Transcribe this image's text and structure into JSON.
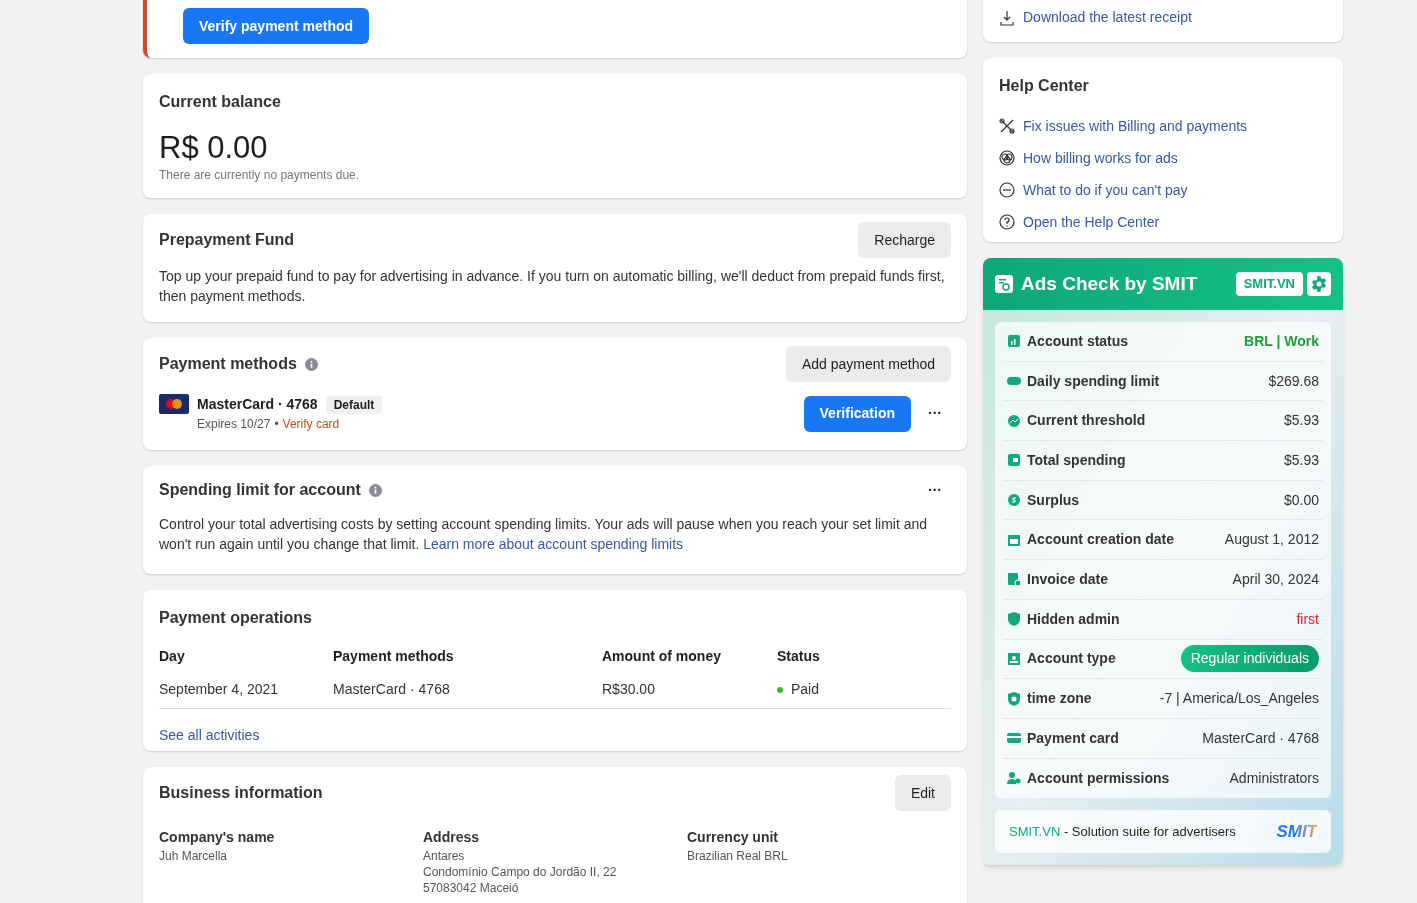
{
  "alert_card": {
    "button": "Verify payment method"
  },
  "balance": {
    "title": "Current balance",
    "amount": "R$ 0.00",
    "note": "There are currently no payments due."
  },
  "prepayment": {
    "title": "Prepayment Fund",
    "button": "Recharge",
    "text": "Top up your prepaid fund to pay for advertising in advance. If you turn on automatic billing, we'll deduct from prepaid funds first, then payment methods."
  },
  "payment_methods": {
    "title": "Payment methods",
    "button": "Add payment method",
    "card": {
      "name": "MasterCard · 4768",
      "badge": "Default",
      "expires": "Expires 10/27",
      "separator": "•",
      "verify": "Verify card",
      "button": "Verification",
      "more": "···"
    }
  },
  "spending_limit": {
    "title": "Spending limit for account",
    "more": "···",
    "text": "Control your total advertising costs by setting account spending limits. Your ads will pause when you reach your set limit and won't run again until you change that limit.",
    "link": "Learn more about account spending limits"
  },
  "payment_operations": {
    "title": "Payment operations",
    "columns": [
      "Day",
      "Payment methods",
      "Amount of money",
      "Status"
    ],
    "rows": [
      {
        "day": "September 4, 2021",
        "method": "MasterCard · 4768",
        "amount": "R$30.00",
        "status": "Paid",
        "color": "#42b72a"
      }
    ],
    "link": "See all activities"
  },
  "business_info": {
    "title": "Business information",
    "button": "Edit",
    "fields": [
      {
        "label": "Company's name",
        "lines": [
          "Juh Marcella"
        ]
      },
      {
        "label": "Address",
        "lines": [
          "Antares",
          "Condomínio Campo do Jordão II, 22",
          "57083042 Maceió"
        ]
      },
      {
        "label": "Currency unit",
        "lines": [
          "Brazilian Real BRL"
        ]
      }
    ]
  },
  "receipt_link": "Download the latest receipt",
  "help_center": {
    "title": "Help Center",
    "links": [
      "Fix issues with Billing and payments",
      "How billing works for ads",
      "What to do if you can't pay",
      "Open the Help Center"
    ]
  },
  "smit_panel": {
    "title": "Ads Check by SMIT",
    "badge": "SMIT.VN",
    "rows": [
      {
        "label": "Account status",
        "value": "BRL | Work",
        "kind": "status"
      },
      {
        "label": "Daily spending limit",
        "value": "$269.68",
        "kind": "plain"
      },
      {
        "label": "Current threshold",
        "value": "$5.93",
        "kind": "plain"
      },
      {
        "label": "Total spending",
        "value": "$5.93",
        "kind": "plain"
      },
      {
        "label": "Surplus",
        "value": "$0.00",
        "kind": "plain"
      },
      {
        "label": "Account creation date",
        "value": "August 1, 2012",
        "kind": "plain"
      },
      {
        "label": "Invoice date",
        "value": "April 30, 2024",
        "kind": "plain"
      },
      {
        "label": "Hidden admin",
        "value": "first",
        "kind": "alert"
      },
      {
        "label": "Account type",
        "value": "Regular individuals",
        "kind": "pill"
      },
      {
        "label": "time zone",
        "value": "-7 | America/Los_Angeles",
        "kind": "plain"
      },
      {
        "label": "Payment card",
        "value": "MasterCard · 4768",
        "kind": "plain"
      },
      {
        "label": "Account permissions",
        "value": "Administrators",
        "kind": "plain"
      }
    ],
    "footer": {
      "brand": "SMIT.VN",
      "text": " - Solution suite for advertisers",
      "logo": "SMIT"
    }
  }
}
